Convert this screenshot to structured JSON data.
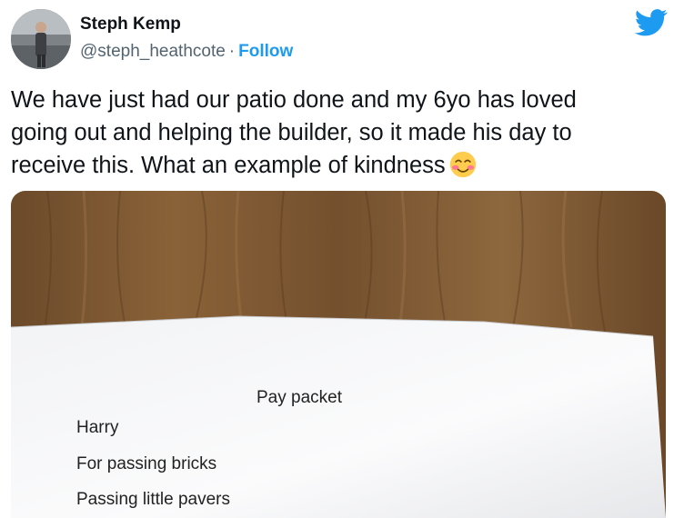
{
  "author": {
    "name": "Steph Kemp",
    "handle": "@steph_heathcote",
    "separator": "·",
    "follow_label": "Follow"
  },
  "icons": {
    "brand": "twitter-bird-icon",
    "emoji": "smiling-face-with-smiling-eyes-emoji"
  },
  "tweet": {
    "line1": "We have just had our patio done and my 6yo has loved",
    "line2": "going out and helping the builder, so it made his day to",
    "line3": "receive this. What an example of kindness"
  },
  "note": {
    "title": "Pay packet",
    "line1": "Harry",
    "line2": "For passing bricks",
    "line3": "Passing little pavers"
  },
  "colors": {
    "twitter_blue": "#1d9bf0",
    "text": "#0f1419",
    "secondary": "#536471"
  }
}
